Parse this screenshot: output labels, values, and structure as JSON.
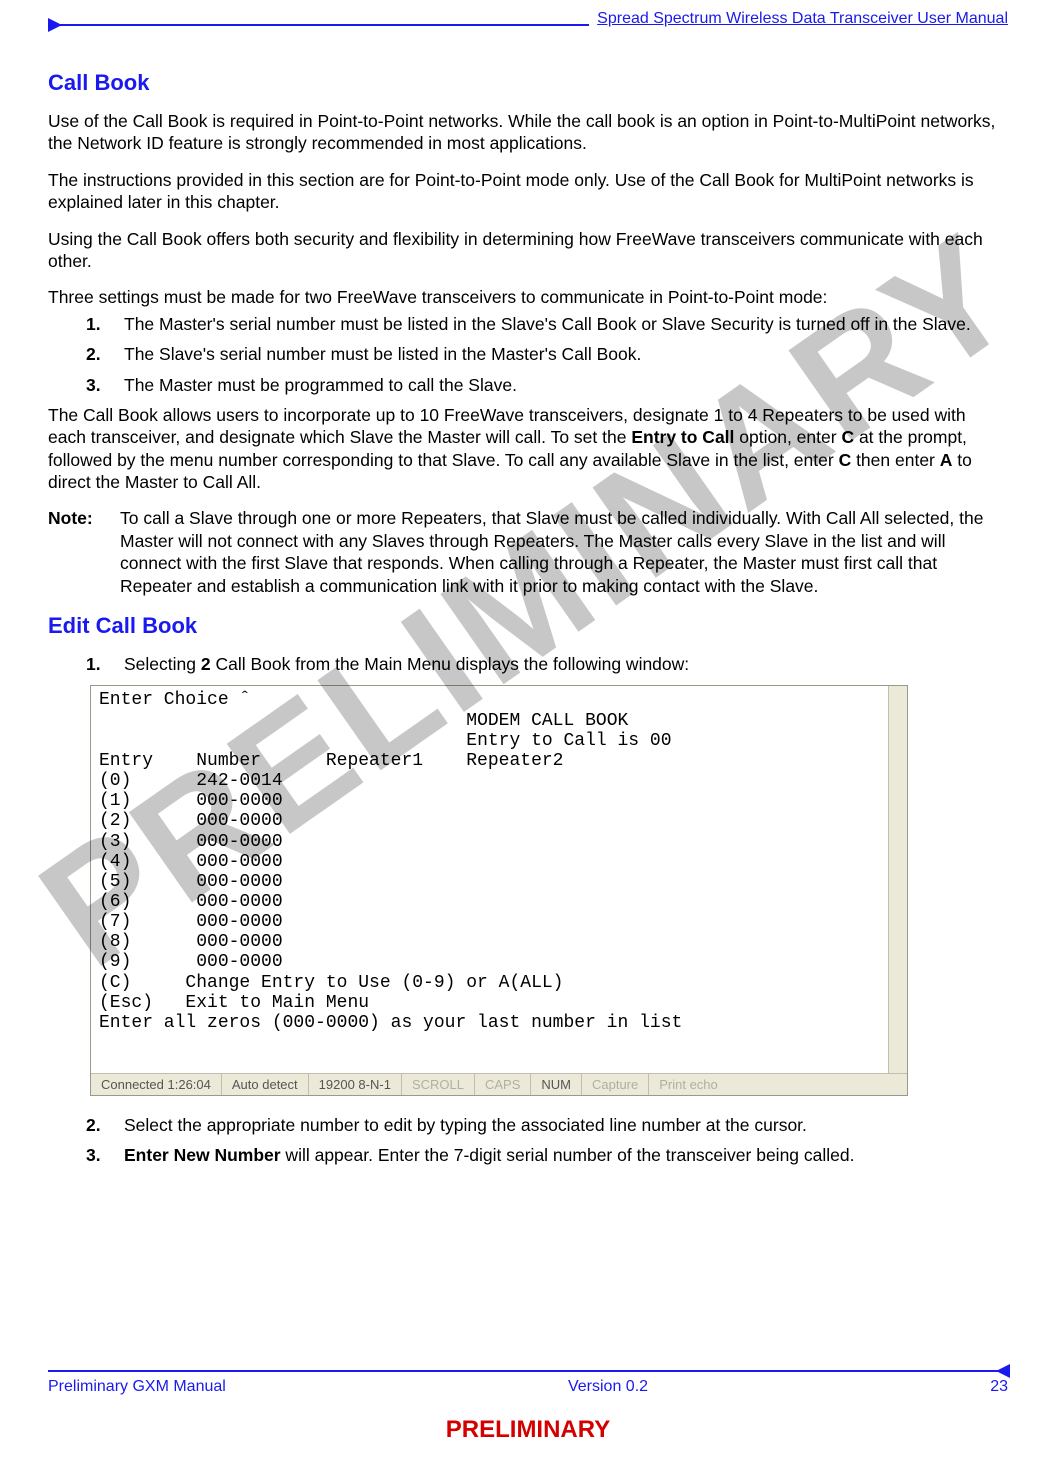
{
  "header": {
    "doc_title": "Spread Spectrum Wireless Data Transceiver User Manual"
  },
  "section1": {
    "heading": "Call Book",
    "p1": "Use of the Call Book is required in Point-to-Point networks. While the call book is an option in Point-to-MultiPoint networks, the Network ID feature is strongly recommended in most applications.",
    "p2": "The instructions provided in this section are for Point-to-Point mode only. Use of the Call Book for MultiPoint networks is explained later in this chapter.",
    "p3": "Using the Call Book offers both security and flexibility in determining how FreeWave transceivers communicate with each other.",
    "p4": "Three settings must be made for two FreeWave transceivers to communicate in Point-to-Point mode:",
    "list": [
      "The Master's serial number must be listed in the Slave's Call Book or Slave Security is turned off in the Slave.",
      "The Slave's serial number must be listed in the Master's Call Book.",
      "The Master must be programmed to call the Slave."
    ],
    "p5_pre": "The Call Book allows users to incorporate up to 10 FreeWave transceivers, designate 1 to 4 Repeaters to be used with each transceiver, and designate which Slave the Master will call.  To set the ",
    "p5_b1": "Entry to Call",
    "p5_mid1": " option, enter ",
    "p5_b2": "C",
    "p5_mid2": " at the prompt, followed by the menu number corresponding to that Slave. To call any available Slave in the list, enter ",
    "p5_b3": "C",
    "p5_mid3": " then enter ",
    "p5_b4": "A",
    "p5_end": " to direct the Master to Call All.",
    "note_label": "Note:",
    "note_text": "To call a Slave through one or more Repeaters, that Slave must be called individually.  With Call All selected, the Master will not connect with any Slaves through Repeaters. The Master calls every Slave in the list and will connect with the first Slave that responds. When calling through a Repeater, the Master must first call that Repeater and establish a communication link with it prior to making contact with the Slave."
  },
  "section2": {
    "heading": "Edit Call Book",
    "step1_pre": "Selecting ",
    "step1_b": "2",
    "step1_post": " Call Book from the Main Menu displays the following window:",
    "step2": "Select the appropriate number to edit by typing the associated line number at the cursor.",
    "step3_b": "Enter New Number",
    "step3_post": " will appear. Enter the 7-digit serial number of the transceiver being called."
  },
  "terminal": {
    "prompt": "Enter Choice ˆ",
    "title": "MODEM CALL BOOK",
    "subtitle": "Entry to Call is 00",
    "cols": "Entry    Number      Repeater1    Repeater2",
    "rows": [
      "(0)      242-0014",
      "(1)      000-0000",
      "(2)      000-0000",
      "(3)      000-0000",
      "(4)      000-0000",
      "(5)      000-0000",
      "(6)      000-0000",
      "(7)      000-0000",
      "(8)      000-0000",
      "(9)      000-0000"
    ],
    "change": "(C)     Change Entry to Use (0-9) or A(ALL)",
    "esc": "(Esc)   Exit to Main Menu",
    "hint": "Enter all zeros (000-0000) as your last number in list"
  },
  "statusbar": {
    "conn": "Connected 1:26:04",
    "detect": "Auto detect",
    "baud": "19200 8-N-1",
    "scroll": "SCROLL",
    "caps": "CAPS",
    "num": "NUM",
    "capture": "Capture",
    "print": "Print echo"
  },
  "footer": {
    "left": "Preliminary GXM Manual",
    "center": "Version 0.2",
    "right": "23",
    "watermark_page": "PRELIMINARY",
    "bottom": "PRELIMINARY"
  }
}
